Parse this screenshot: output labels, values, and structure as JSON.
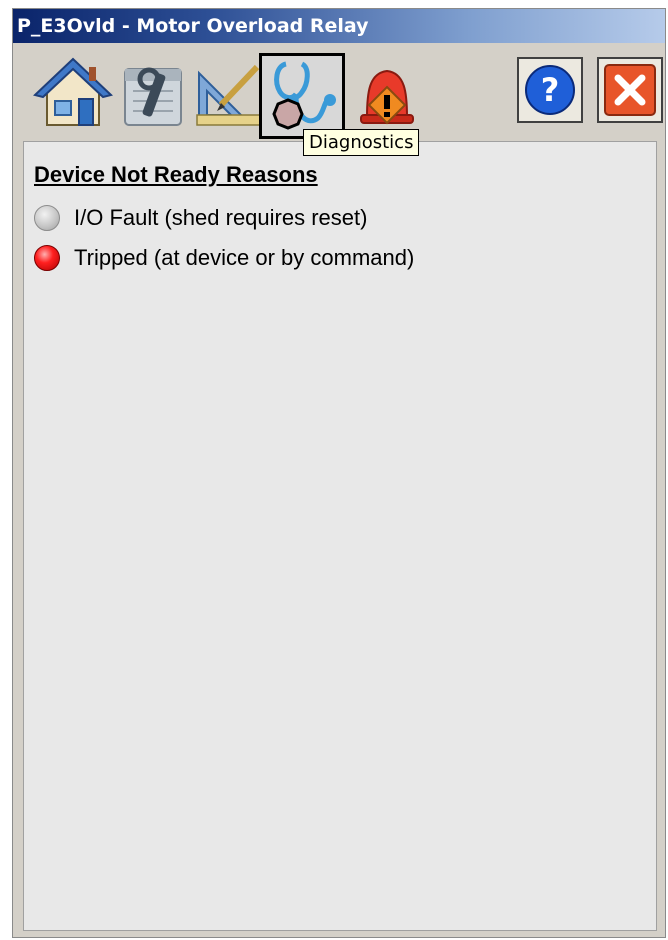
{
  "window": {
    "title": "P_E3Ovld - Motor Overload Relay"
  },
  "toolbar": {
    "buttons": [
      {
        "icon": "home-icon"
      },
      {
        "icon": "maintenance-icon"
      },
      {
        "icon": "engineering-icon"
      },
      {
        "icon": "diagnostics-icon",
        "active": true
      },
      {
        "icon": "alarm-icon"
      }
    ],
    "help_icon": "help-icon",
    "close_icon": "close-icon",
    "tooltip": "Diagnostics"
  },
  "panel": {
    "title": "Device Not Ready Reasons",
    "reasons": [
      {
        "label": "I/O Fault (shed requires reset)",
        "state": "off",
        "color": "#b0b0b0"
      },
      {
        "label": "Tripped (at device or by command)",
        "state": "on",
        "color": "#ff0000"
      }
    ]
  }
}
